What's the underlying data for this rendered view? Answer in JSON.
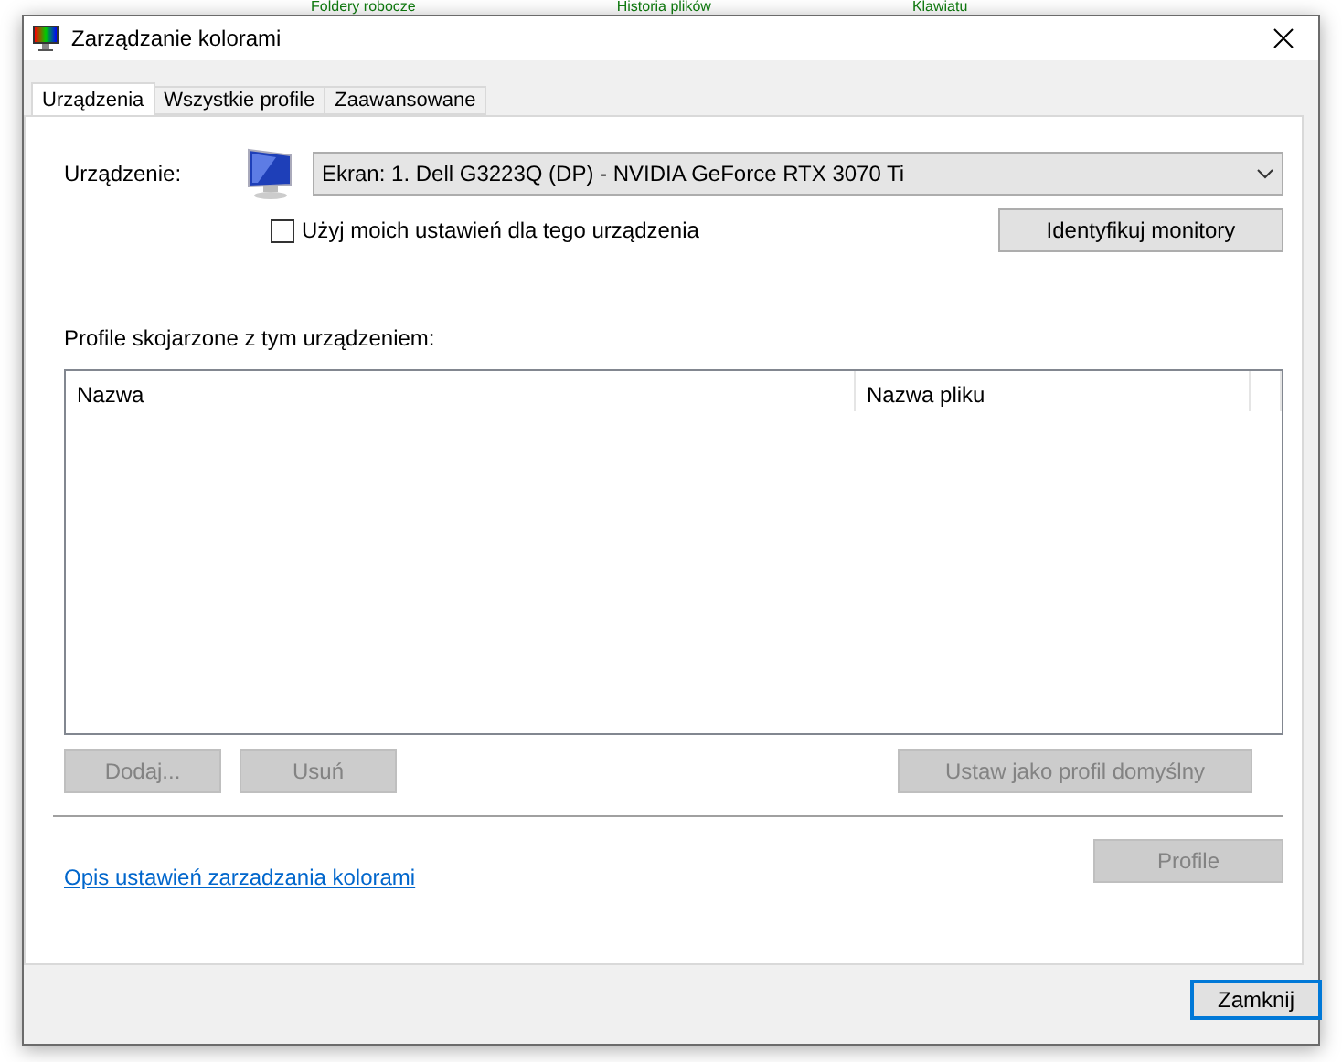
{
  "background_items": [
    "Foldery robocze",
    "Historia plików",
    "Klawiatu"
  ],
  "window": {
    "title": "Zarządzanie kolorami"
  },
  "tabs": [
    {
      "label": "Urządzenia",
      "selected": true
    },
    {
      "label": "Wszystkie profile",
      "selected": false
    },
    {
      "label": "Zaawansowane",
      "selected": false
    }
  ],
  "device": {
    "label": "Urządzenie:",
    "value": "Ekran: 1. Dell G3223Q (DP) - NVIDIA GeForce RTX 3070 Ti",
    "use_my_settings": {
      "label": "Użyj moich ustawień dla tego urządzenia",
      "checked": false
    },
    "identify_button": "Identyfikuj monitory"
  },
  "profiles": {
    "label": "Profile skojarzone z tym urządzeniem:",
    "columns": [
      "Nazwa",
      "Nazwa pliku"
    ]
  },
  "list_buttons": [
    {
      "label": "Dodaj...",
      "disabled": true
    },
    {
      "label": "Usuń",
      "disabled": true
    },
    {
      "label": "Ustaw jako profil domyślny",
      "disabled": true
    }
  ],
  "link": "Opis ustawień zarzadzania kolorami",
  "profile_button": {
    "label": "Profile",
    "disabled": true
  },
  "close_button": "Zamknij"
}
